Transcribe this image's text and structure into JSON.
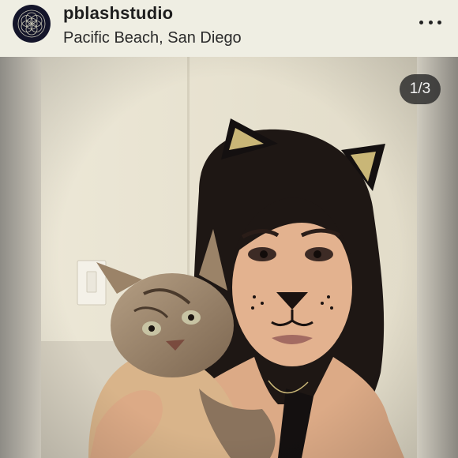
{
  "post": {
    "username": "pblashstudio",
    "location": "Pacific Beach, San Diego",
    "image_counter": "1/3"
  },
  "icons": {
    "avatar": "seed-of-life-logo",
    "more": "more-options-icon"
  },
  "colors": {
    "header_bg": "#efeee3",
    "text": "#1e1e1e",
    "counter_bg": "#2a2a2a"
  }
}
